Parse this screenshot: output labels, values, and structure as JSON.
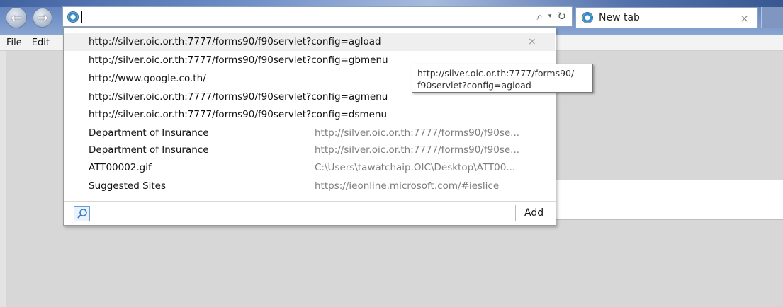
{
  "browser": {
    "address_value": "",
    "tab": {
      "label": "New tab",
      "close_glyph": "×"
    },
    "address_tools": {
      "search": "⌕",
      "dropdown": "▾",
      "refresh": "↻"
    },
    "nav": {
      "back": "←",
      "forward": "→"
    }
  },
  "menubar": {
    "items": [
      "File",
      "Edit"
    ]
  },
  "dropdown": {
    "history_urls": [
      "http://silver.oic.or.th:7777/forms90/f90servlet?config=agload",
      "http://silver.oic.or.th:7777/forms90/f90servlet?config=gbmenu",
      "http://www.google.co.th/",
      "http://silver.oic.or.th:7777/forms90/f90servlet?config=agmenu",
      "http://silver.oic.or.th:7777/forms90/f90servlet?config=dsmenu"
    ],
    "delete_glyph": "×",
    "favorites": [
      {
        "title": "Department of Insurance",
        "address": "http://silver.oic.or.th:7777/forms90/f90se..."
      },
      {
        "title": "Department of Insurance",
        "address": "http://silver.oic.or.th:7777/forms90/f90se..."
      },
      {
        "title": "ATT00002.gif",
        "address": "C:\\Users\\tawatchaip.OIC\\Desktop\\ATT00..."
      },
      {
        "title": "Suggested Sites",
        "address": "https://ieonline.microsoft.com/#ieslice"
      }
    ],
    "footer": {
      "add_label": "Add"
    }
  },
  "tooltip": {
    "line1": "http://silver.oic.or.th:7777/forms90/",
    "line2": "f90servlet?config=agload"
  },
  "icons": {
    "back": "back-arrow-icon",
    "forward": "forward-arrow-icon",
    "ie": "internet-explorer-icon",
    "search": "search-icon",
    "refresh": "refresh-icon",
    "close": "close-icon"
  },
  "colors": {
    "titlebar": "#6c8cc4",
    "highlight_row": "#efefef",
    "muted_text": "#7d7d7d"
  }
}
